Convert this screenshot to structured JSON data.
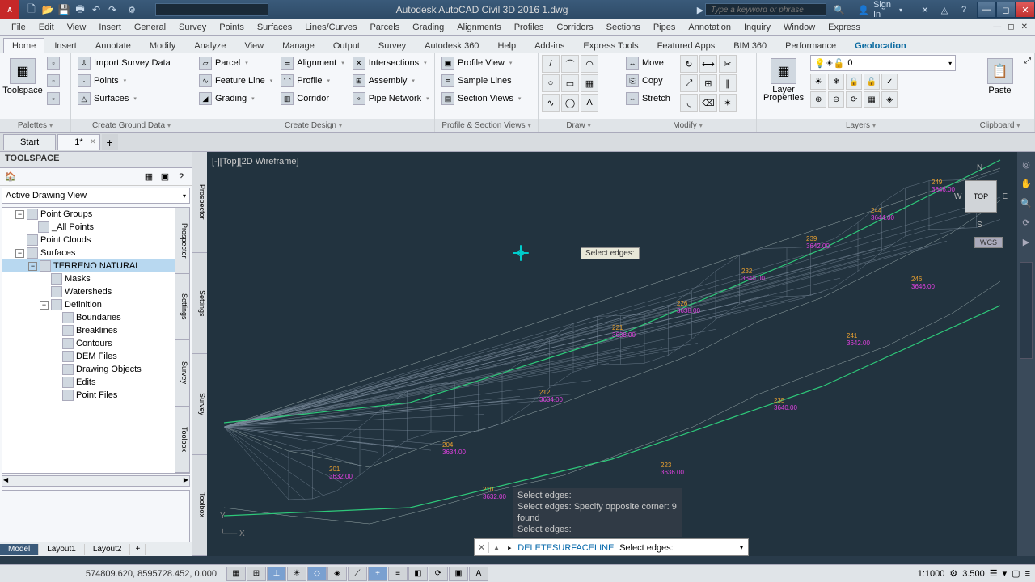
{
  "titlebar": {
    "app_title": "Autodesk AutoCAD Civil 3D 2016   1.dwg",
    "search_keyword_placeholder": "Type a keyword or phrase",
    "signin": "Sign In",
    "quick_search_placeholder": ""
  },
  "menubar": [
    "File",
    "Edit",
    "View",
    "Insert",
    "General",
    "Survey",
    "Points",
    "Surfaces",
    "Lines/Curves",
    "Parcels",
    "Grading",
    "Alignments",
    "Profiles",
    "Corridors",
    "Sections",
    "Pipes",
    "Annotation",
    "Inquiry",
    "Window",
    "Express"
  ],
  "ribbon_tabs": [
    "Home",
    "Insert",
    "Annotate",
    "Modify",
    "Analyze",
    "View",
    "Manage",
    "Output",
    "Survey",
    "Autodesk 360",
    "Help",
    "Add-ins",
    "Express Tools",
    "Featured Apps",
    "BIM 360",
    "Performance",
    "Geolocation"
  ],
  "ribbon_active_tab": "Home",
  "ribbon": {
    "palettes": {
      "big": "Toolspace",
      "title": "Palettes"
    },
    "ground_data": {
      "import": "Import Survey Data",
      "points": "Points",
      "surfaces": "Surfaces",
      "title": "Create Ground Data"
    },
    "design": {
      "parcel": "Parcel",
      "feature_line": "Feature Line",
      "grading": "Grading",
      "alignment": "Alignment",
      "profile": "Profile",
      "corridor": "Corridor",
      "intersections": "Intersections",
      "assembly": "Assembly",
      "pipe_network": "Pipe Network",
      "title": "Create Design"
    },
    "profile_views": {
      "profile_view": "Profile View",
      "sample_lines": "Sample Lines",
      "section_views": "Section Views",
      "title": "Profile & Section Views"
    },
    "draw": {
      "title": "Draw"
    },
    "modify": {
      "move": "Move",
      "copy": "Copy",
      "stretch": "Stretch",
      "title": "Modify"
    },
    "layers": {
      "big": "Layer\nProperties",
      "combo": "0",
      "title": "Layers"
    },
    "clipboard": {
      "big": "Paste",
      "title": "Clipboard"
    }
  },
  "doc_tabs": {
    "start": "Start",
    "file": "1*"
  },
  "toolspace": {
    "title": "TOOLSPACE",
    "view_combo": "Active Drawing View",
    "vtabs": [
      "Prospector",
      "Settings",
      "Survey",
      "Toolbox"
    ],
    "tree": {
      "point_groups": "Point Groups",
      "all_points": "_All Points",
      "point_clouds": "Point Clouds",
      "surfaces": "Surfaces",
      "surface_name": "TERRENO NATURAL",
      "masks": "Masks",
      "watersheds": "Watersheds",
      "definition": "Definition",
      "boundaries": "Boundaries",
      "breaklines": "Breaklines",
      "contours": "Contours",
      "dem": "DEM Files",
      "drawing_objects": "Drawing Objects",
      "edits": "Edits",
      "point_files": "Point Files"
    }
  },
  "viewport": {
    "label": "[-][Top][2D Wireframe]",
    "viewcube": "TOP",
    "wcs": "WCS",
    "tooltip": "Select edges:"
  },
  "cmd_history": [
    "Select edges:",
    "Select edges: Specify opposite corner: 9",
    "found",
    "Select edges:"
  ],
  "cmdline": {
    "command": "DELETESURFACELINE",
    "prompt": "Select edges:"
  },
  "layout_tabs": [
    "Model",
    "Layout1",
    "Layout2"
  ],
  "statusbar": {
    "coords": "574809.620, 8595728.452, 0.000",
    "scale": "1:1000",
    "anno": "3.500"
  }
}
